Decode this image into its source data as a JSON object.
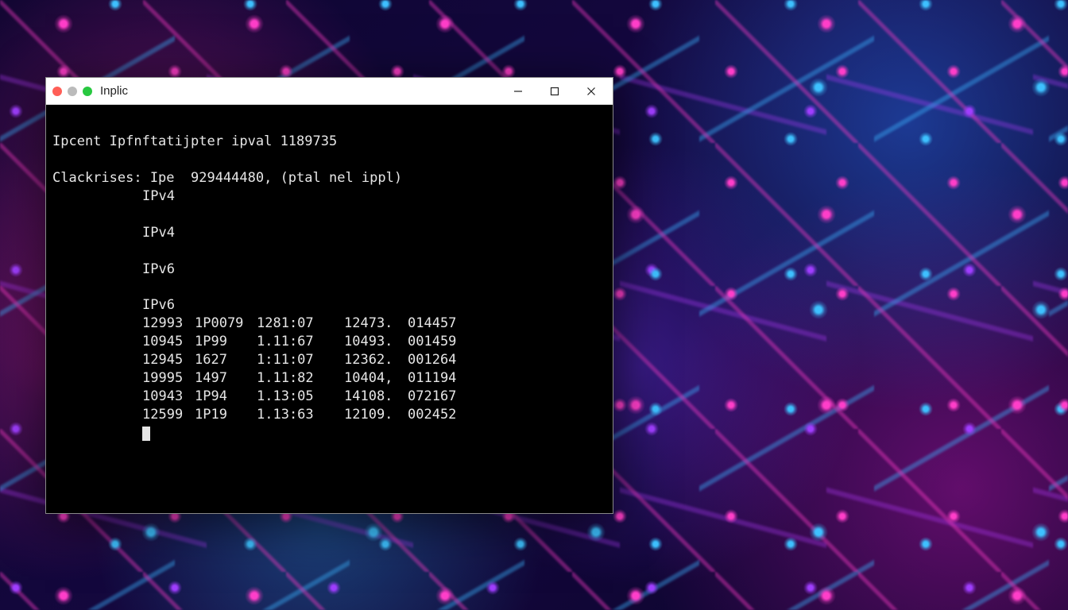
{
  "window": {
    "title": "Inplic"
  },
  "terminal": {
    "line1": "Ipcent Ipfnftatijpter ipval 1189735",
    "line2": "Clackrises: Ipe  929444480, (ptal nel ippl)",
    "labels": [
      "IPv4",
      "IPv4",
      "IPv6",
      "IPv6"
    ],
    "rows": [
      {
        "c1": "12993",
        "c2": "1P0079",
        "c3": "1281:07",
        "c4": "12473.",
        "c5": "014457"
      },
      {
        "c1": "10945",
        "c2": "1P99",
        "c3": "1.11:67",
        "c4": "10493.",
        "c5": "001459"
      },
      {
        "c1": "12945",
        "c2": "1627",
        "c3": "1:11:07",
        "c4": "12362.",
        "c5": "001264"
      },
      {
        "c1": "19995",
        "c2": "1497",
        "c3": "1.11:82",
        "c4": "10404,",
        "c5": "011194"
      },
      {
        "c1": "10943",
        "c2": "1P94",
        "c3": "1.13:05",
        "c4": "14108.",
        "c5": "072167"
      },
      {
        "c1": "12599",
        "c2": "1P19",
        "c3": "1.13:63",
        "c4": "12109.",
        "c5": "002452"
      }
    ]
  }
}
